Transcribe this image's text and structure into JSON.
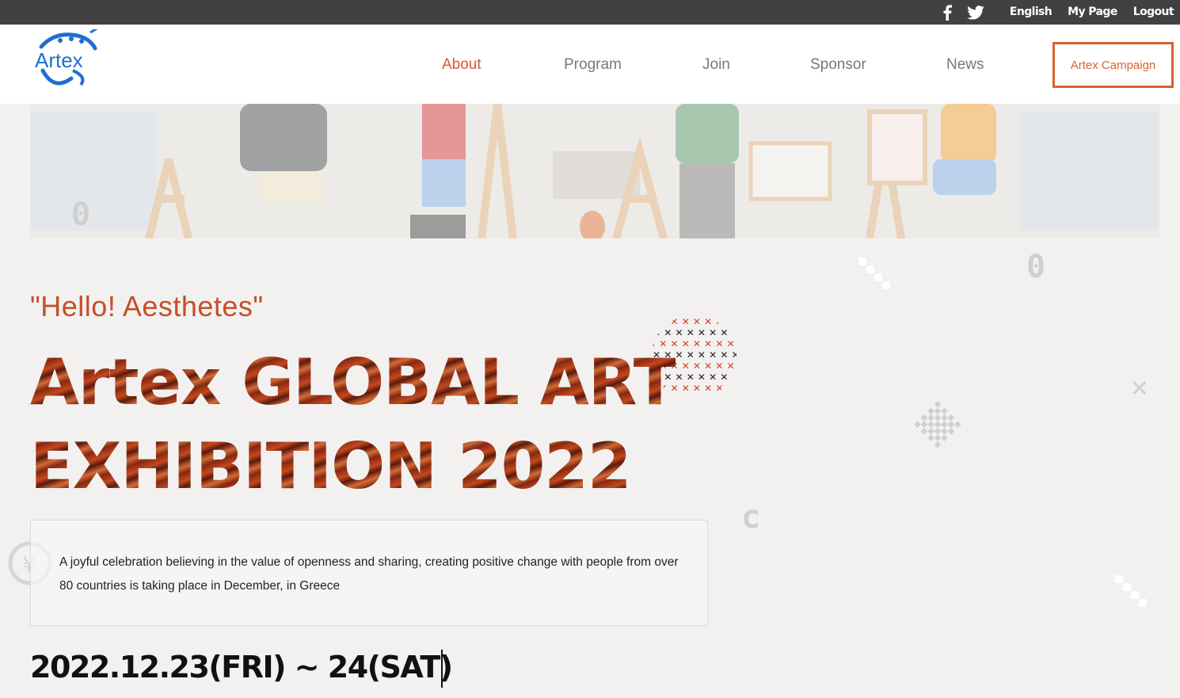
{
  "topbar": {
    "social": [
      "facebook-icon",
      "twitter-icon"
    ],
    "links": [
      "English",
      "My Page",
      "Logout"
    ]
  },
  "header": {
    "logo_text": "Artex",
    "nav": [
      {
        "label": "About",
        "active": true
      },
      {
        "label": "Program",
        "active": false
      },
      {
        "label": "Join",
        "active": false
      },
      {
        "label": "Sponsor",
        "active": false
      },
      {
        "label": "News",
        "active": false
      }
    ],
    "campaign_label": "Artex Campaign"
  },
  "main": {
    "greeting": "\"Hello! Aesthetes\"",
    "title_line1_a": "Artex",
    "title_line1_b": "GLOBAL ART",
    "title_line2": "EXHIBITION 2022",
    "description": "A joyful celebration believing in the value of openness and sharing, creating positive change with people from over 80 countries is taking place in December, in Greece",
    "dates": "2022.12.23(FRI) ~ 24(SAT)"
  },
  "colors": {
    "accent": "#e1542d",
    "campaign_border": "#d9622f",
    "topbar_bg": "#424040",
    "greeting": "#c44f2a"
  }
}
